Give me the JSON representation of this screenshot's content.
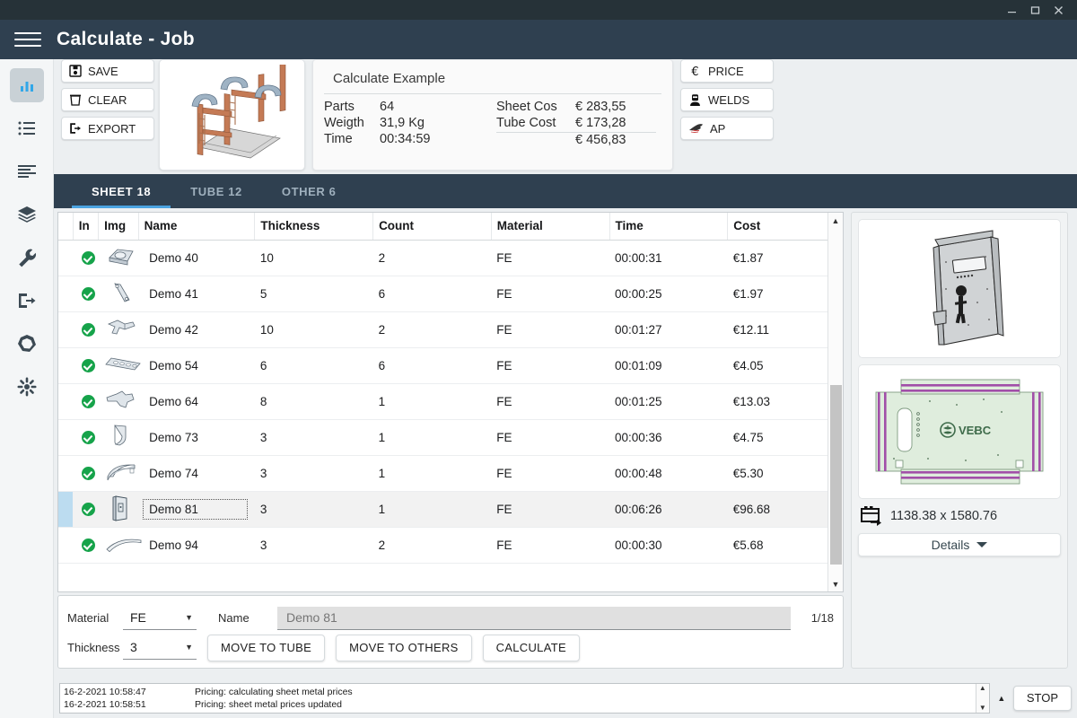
{
  "window": {
    "minimize": "–",
    "maximize": "□",
    "close": "✕"
  },
  "header": {
    "menu_icon": "hamburger-icon",
    "title": "Calculate  -  Job"
  },
  "sidebar": {
    "items": [
      {
        "name": "dashboard",
        "icon": "bar-chart-icon",
        "active": true
      },
      {
        "name": "list",
        "icon": "list-icon",
        "active": false
      },
      {
        "name": "report",
        "icon": "text-lines-icon",
        "active": false
      },
      {
        "name": "layers",
        "icon": "layers-icon",
        "active": false
      },
      {
        "name": "tools",
        "icon": "wrench-icon",
        "active": false
      },
      {
        "name": "logout",
        "icon": "exit-icon",
        "active": false
      },
      {
        "name": "nesting",
        "icon": "polygon-icon",
        "active": false
      },
      {
        "name": "settings",
        "icon": "asterisk-icon",
        "active": false
      }
    ]
  },
  "toolbar": {
    "save_label": "SAVE",
    "clear_label": "CLEAR",
    "export_label": "EXPORT",
    "price_label": "PRICE",
    "welds_label": "WELDS",
    "ap_label": "AP"
  },
  "summary": {
    "title": "Calculate Example",
    "parts_label": "Parts",
    "parts_value": "64",
    "weight_label": "Weigth",
    "weight_value": "31,9 Kg",
    "time_label": "Time",
    "time_value": "00:34:59",
    "sheet_cost_label": "Sheet Cos",
    "sheet_cost_value": "€ 283,55",
    "tube_cost_label": "Tube Cost",
    "tube_cost_value": "€ 173,28",
    "total_label": "",
    "total_value": "€ 456,83"
  },
  "tabs": [
    {
      "label": "SHEET 18",
      "active": true
    },
    {
      "label": "TUBE 12",
      "active": false
    },
    {
      "label": "OTHER 6",
      "active": false
    }
  ],
  "table": {
    "columns": [
      "In",
      "Img",
      "Name",
      "Thickness",
      "Count",
      "Material",
      "Time",
      "Cost"
    ],
    "rows": [
      {
        "checked": true,
        "img": "part-washer-icon",
        "name": "Demo 40",
        "thickness": "10",
        "count": "2",
        "material": "FE",
        "time": "00:00:31",
        "cost": "€1.87",
        "selected": false
      },
      {
        "checked": true,
        "img": "part-lever-icon",
        "name": "Demo 41",
        "thickness": "5",
        "count": "6",
        "material": "FE",
        "time": "00:00:25",
        "cost": "€1.97",
        "selected": false
      },
      {
        "checked": true,
        "img": "part-bracket-icon",
        "name": "Demo 42",
        "thickness": "10",
        "count": "2",
        "material": "FE",
        "time": "00:01:27",
        "cost": "€12.11",
        "selected": false
      },
      {
        "checked": true,
        "img": "part-strip-icon",
        "name": "Demo 54",
        "thickness": "6",
        "count": "6",
        "material": "FE",
        "time": "00:01:09",
        "cost": "€4.05",
        "selected": false
      },
      {
        "checked": true,
        "img": "part-wedge-icon",
        "name": "Demo 64",
        "thickness": "8",
        "count": "1",
        "material": "FE",
        "time": "00:01:25",
        "cost": "€13.03",
        "selected": false
      },
      {
        "checked": true,
        "img": "part-bend-icon",
        "name": "Demo 73",
        "thickness": "3",
        "count": "1",
        "material": "FE",
        "time": "00:00:36",
        "cost": "€4.75",
        "selected": false
      },
      {
        "checked": true,
        "img": "part-curve-icon",
        "name": "Demo 74",
        "thickness": "3",
        "count": "1",
        "material": "FE",
        "time": "00:00:48",
        "cost": "€5.30",
        "selected": false
      },
      {
        "checked": true,
        "img": "part-panel-icon",
        "name": "Demo 81",
        "thickness": "3",
        "count": "1",
        "material": "FE",
        "time": "00:06:26",
        "cost": "€96.68",
        "selected": true
      },
      {
        "checked": true,
        "img": "part-arc-icon",
        "name": "Demo 94",
        "thickness": "3",
        "count": "2",
        "material": "FE",
        "time": "00:00:30",
        "cost": "€5.68",
        "selected": false
      }
    ]
  },
  "controls": {
    "material_label": "Material",
    "material_value": "FE",
    "name_label": "Name",
    "name_placeholder": "Demo 81",
    "page_counter": "1/18",
    "thickness_label": "Thickness",
    "thickness_value": "3",
    "move_to_tube_label": "MOVE TO TUBE",
    "move_to_others_label": "MOVE TO OTHERS",
    "calculate_label": "CALCULATE"
  },
  "right_panel": {
    "iso_preview": "part-3d-preview",
    "flat_preview": "part-flat-pattern",
    "flat_logo": "vebc-logo",
    "dimensions": "1138.38 x 1580.76",
    "dimension_icon": "sheet-size-icon",
    "details_label": "Details",
    "details_caret": "chevron-down-icon"
  },
  "status": {
    "log": [
      {
        "time": "16-2-2021 10:58:47",
        "message": "Pricing: calculating sheet metal prices"
      },
      {
        "time": "16-2-2021 10:58:51",
        "message": "Pricing: sheet metal prices updated"
      }
    ],
    "collapse_icon": "triangle-up-icon",
    "stop_label": "STOP"
  },
  "colors": {
    "header_bg": "#2f4050",
    "titlebar_bg": "#263238",
    "tab_accent": "#4aa3e0",
    "check_green": "#16a34a",
    "selection_blue": "#bcdcf0",
    "app_bg": "#eceff1"
  }
}
